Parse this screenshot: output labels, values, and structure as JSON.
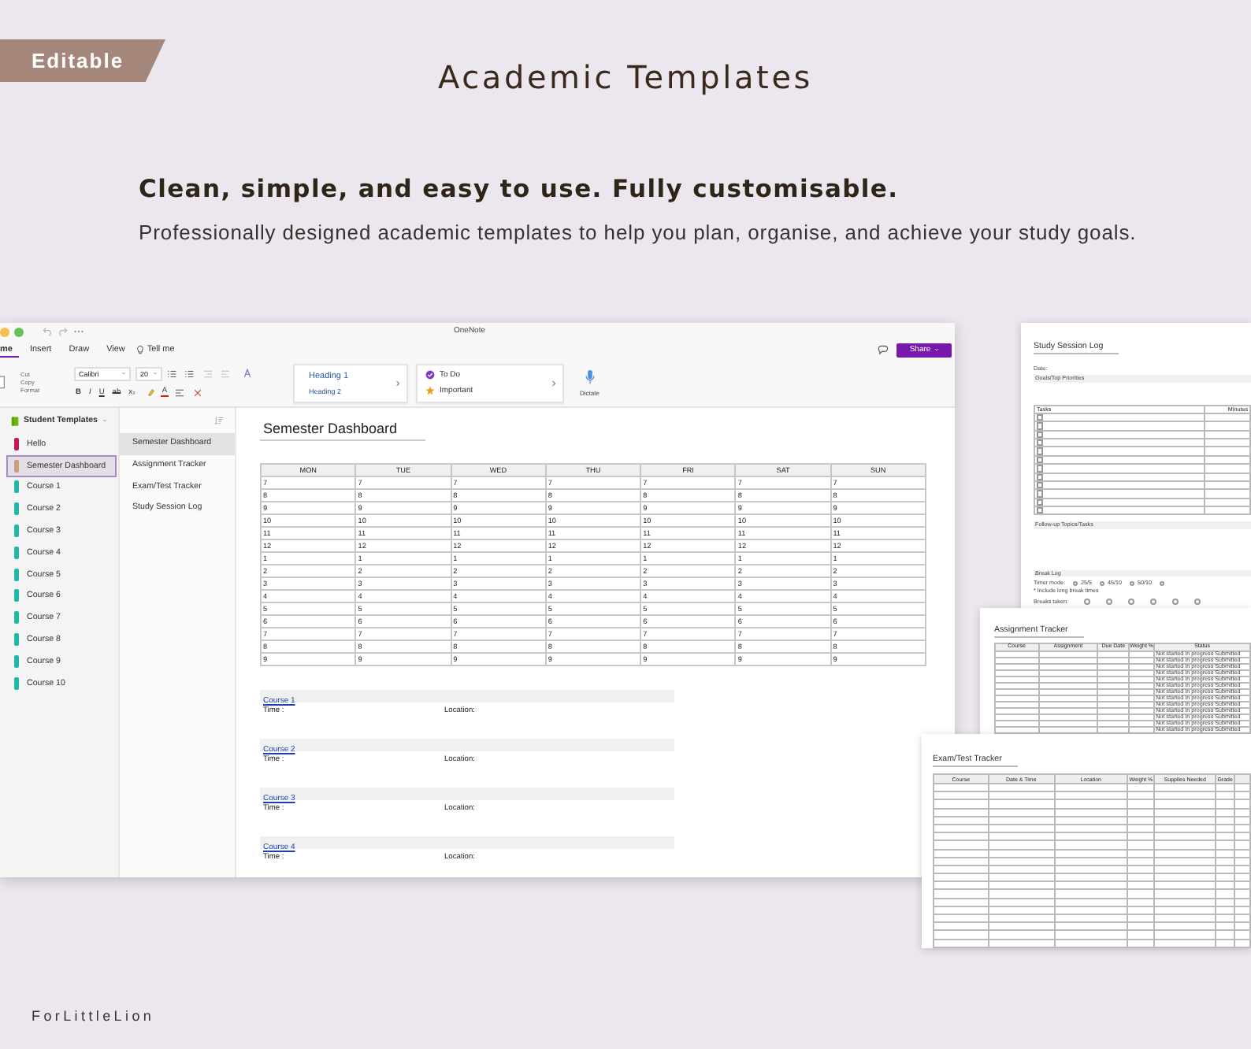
{
  "badge": "Editable",
  "title": "Academic Templates",
  "headline": "Clean, simple, and easy to use. Fully customisable.",
  "description": "Professionally designed academic templates to help you plan, organise, and achieve your study goals.",
  "onenote": {
    "app_title": "OneNote",
    "menu_tabs": [
      {
        "label": "me",
        "selected": true
      },
      {
        "label": "Insert",
        "selected": false
      },
      {
        "label": "Draw",
        "selected": false
      },
      {
        "label": "View",
        "selected": false
      }
    ],
    "tell_me": "Tell me",
    "share": "Share",
    "clipboard": [
      "Cut",
      "Copy",
      "Format"
    ],
    "font": "Calibri",
    "font_size": "20",
    "format_buttons": [
      "B",
      "I",
      "U",
      "ab",
      "x₂"
    ],
    "font_color": "A",
    "styles": [
      "Heading 1",
      "Heading 2"
    ],
    "tags": [
      {
        "label": "To Do",
        "kind": "todo"
      },
      {
        "label": "Important",
        "kind": "star"
      }
    ],
    "dictate": "Dictate",
    "notebook": "Student Templates",
    "sections": [
      {
        "label": "Hello",
        "color": "#c2185b",
        "selected": false
      },
      {
        "label": "Semester Dashboard",
        "color": "#c9a07a",
        "selected": true
      },
      {
        "label": "Course 1",
        "color": "#1fb8a6",
        "selected": false
      },
      {
        "label": "Course 2",
        "color": "#1fb8a6",
        "selected": false
      },
      {
        "label": "Course 3",
        "color": "#1fb8a6",
        "selected": false
      },
      {
        "label": "Course 4",
        "color": "#1fb8a6",
        "selected": false
      },
      {
        "label": "Course 5",
        "color": "#1fb8a6",
        "selected": false
      },
      {
        "label": "Course 6",
        "color": "#1fb8a6",
        "selected": false
      },
      {
        "label": "Course 7",
        "color": "#1fb8a6",
        "selected": false
      },
      {
        "label": "Course 8",
        "color": "#1fb8a6",
        "selected": false
      },
      {
        "label": "Course 9",
        "color": "#1fb8a6",
        "selected": false
      },
      {
        "label": "Course 10",
        "color": "#1fb8a6",
        "selected": false
      }
    ],
    "pages": [
      {
        "label": "Semester Dashboard",
        "selected": true
      },
      {
        "label": "Assignment Tracker",
        "selected": false
      },
      {
        "label": "Exam/Test Tracker",
        "selected": false
      },
      {
        "label": "Study Session Log",
        "selected": false
      }
    ],
    "page_title": "Semester Dashboard",
    "schedule": {
      "columns": [
        "MON",
        "TUE",
        "WED",
        "THU",
        "FRI",
        "SAT",
        "SUN"
      ],
      "rows": [
        [
          "7",
          "7",
          "7",
          "7",
          "7",
          "7",
          "7"
        ],
        [
          "8",
          "8",
          "8",
          "8",
          "8",
          "8",
          "8"
        ],
        [
          "9",
          "9",
          "9",
          "9",
          "9",
          "9",
          "9"
        ],
        [
          "10",
          "10",
          "10",
          "10",
          "10",
          "10",
          "10"
        ],
        [
          "11",
          "11",
          "11",
          "11",
          "11",
          "11",
          "11"
        ],
        [
          "12",
          "12",
          "12",
          "12",
          "12",
          "12",
          "12"
        ],
        [
          "1",
          "1",
          "1",
          "1",
          "1",
          "1",
          "1"
        ],
        [
          "2",
          "2",
          "2",
          "2",
          "2",
          "2",
          "2"
        ],
        [
          "3",
          "3",
          "3",
          "3",
          "3",
          "3",
          "3"
        ],
        [
          "4",
          "4",
          "4",
          "4",
          "4",
          "4",
          "4"
        ],
        [
          "5",
          "5",
          "5",
          "5",
          "5",
          "5",
          "5"
        ],
        [
          "6",
          "6",
          "6",
          "6",
          "6",
          "6",
          "6"
        ],
        [
          "7",
          "7",
          "7",
          "7",
          "7",
          "7",
          "7"
        ],
        [
          "8",
          "8",
          "8",
          "8",
          "8",
          "8",
          "8"
        ],
        [
          "9",
          "9",
          "9",
          "9",
          "9",
          "9",
          "9"
        ]
      ]
    },
    "courses": [
      {
        "name": "Course 1",
        "time_label": "Time :",
        "location_label": "Location:"
      },
      {
        "name": "Course 2",
        "time_label": "Time :",
        "location_label": "Location:"
      },
      {
        "name": "Course 3",
        "time_label": "Time :",
        "location_label": "Location:"
      },
      {
        "name": "Course 4",
        "time_label": "Time :",
        "location_label": "Location:"
      }
    ]
  },
  "study_session_log": {
    "title": "Study Session Log",
    "date_label": "Date:",
    "goals_label": "Goals/Top Priorities",
    "task_header": "Tasks",
    "minutes_header": "Minutes",
    "tasks": [
      {
        "checked": false
      },
      {
        "checked": false
      },
      {
        "checked": false
      },
      {
        "checked": false
      },
      {
        "checked": false
      },
      {
        "checked": false
      },
      {
        "checked": false
      },
      {
        "checked": false
      },
      {
        "checked": false
      },
      {
        "checked": false
      },
      {
        "checked": false
      },
      {
        "checked": false
      }
    ],
    "followup_label": "Follow-up Topics/Tasks",
    "break_log_label": "Break Log",
    "timer_label": "Timer mode:",
    "timer_options": [
      {
        "label": "25/5",
        "selected": false
      },
      {
        "label": "45/10",
        "selected": false
      },
      {
        "label": "50/10",
        "selected": false
      },
      {
        "selected": false
      }
    ],
    "timer_note": "* Include long break times",
    "breaks_label": "Breaks taken:",
    "breaks": [
      {
        "checked": false
      },
      {
        "checked": false
      },
      {
        "checked": false
      },
      {
        "checked": false
      },
      {
        "checked": false
      },
      {
        "checked": false
      }
    ]
  },
  "assignment_tracker": {
    "title": "Assignment Tracker",
    "columns": [
      "Course",
      "Assignment",
      "Due Date",
      "Weight %",
      "Status"
    ],
    "rows": [
      {
        "status": [
          "Not started",
          "In progress",
          "Submitted"
        ]
      },
      {
        "status": [
          "Not started",
          "In progress",
          "Submitted"
        ]
      },
      {
        "status": [
          "Not started",
          "In progress",
          "Submitted"
        ]
      },
      {
        "status": [
          "Not started",
          "In progress",
          "Submitted"
        ]
      },
      {
        "status": [
          "Not started",
          "In progress",
          "Submitted"
        ]
      },
      {
        "status": [
          "Not started",
          "In progress",
          "Submitted"
        ]
      },
      {
        "status": [
          "Not started",
          "In progress",
          "Submitted"
        ]
      },
      {
        "status": [
          "Not started",
          "In progress",
          "Submitted"
        ]
      },
      {
        "status": [
          "Not started",
          "In progress",
          "Submitted"
        ]
      },
      {
        "status": [
          "Not started",
          "In progress",
          "Submitted"
        ]
      },
      {
        "status": [
          "Not started",
          "In progress",
          "Submitted"
        ]
      },
      {
        "status": [
          "Not started",
          "In progress",
          "Submitted"
        ]
      },
      {
        "status": [
          "Not started",
          "In progress",
          "Submitted"
        ]
      }
    ]
  },
  "exam_tracker": {
    "title": "Exam/Test Tracker",
    "columns": [
      "Course",
      "Date & Time",
      "Location",
      "Weight %",
      "Supplies Needed",
      "Grade"
    ]
  },
  "footer": "ForLittleLion"
}
